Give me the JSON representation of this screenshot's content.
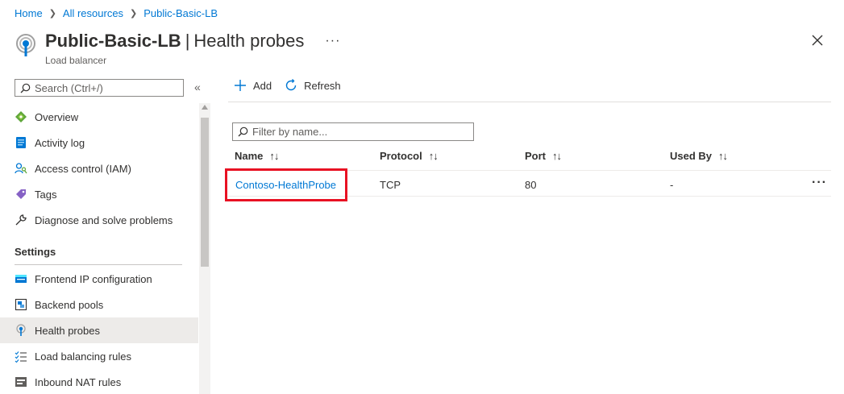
{
  "breadcrumb": [
    "Home",
    "All resources",
    "Public-Basic-LB"
  ],
  "header": {
    "resource_name": "Public-Basic-LB",
    "separator": "|",
    "blade_title": "Health probes",
    "subtitle": "Load balancer",
    "more": "···"
  },
  "sidebar": {
    "search_placeholder": "Search (Ctrl+/)",
    "collapse": "«",
    "top_items": [
      {
        "label": "Overview",
        "icon": "overview-icon"
      },
      {
        "label": "Activity log",
        "icon": "activity-log-icon"
      },
      {
        "label": "Access control (IAM)",
        "icon": "iam-icon"
      },
      {
        "label": "Tags",
        "icon": "tag-icon"
      },
      {
        "label": "Diagnose and solve problems",
        "icon": "wrench-icon"
      }
    ],
    "section_label": "Settings",
    "settings_items": [
      {
        "label": "Frontend IP configuration",
        "icon": "frontend-ip-icon"
      },
      {
        "label": "Backend pools",
        "icon": "backend-pools-icon"
      },
      {
        "label": "Health probes",
        "icon": "health-probe-icon",
        "active": true
      },
      {
        "label": "Load balancing rules",
        "icon": "rules-list-icon"
      },
      {
        "label": "Inbound NAT rules",
        "icon": "nat-rules-icon"
      }
    ]
  },
  "toolbar": {
    "add_label": "Add",
    "refresh_label": "Refresh"
  },
  "filter": {
    "placeholder": "Filter by name..."
  },
  "table": {
    "columns": [
      "Name",
      "Protocol",
      "Port",
      "Used By"
    ],
    "sort_glyph": "↑↓",
    "rows": [
      {
        "name": "Contoso-HealthProbe",
        "protocol": "TCP",
        "port": "80",
        "used_by": "-"
      }
    ],
    "row_more": "···"
  },
  "colors": {
    "link": "#0078d4",
    "highlight": "#e81123",
    "active_nav": "#edebe9"
  }
}
